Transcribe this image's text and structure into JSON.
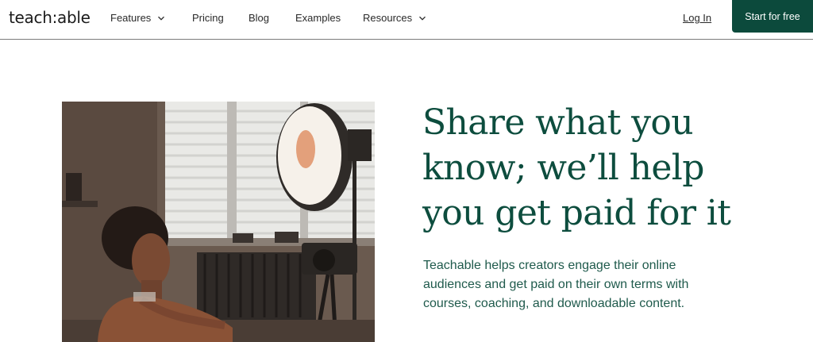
{
  "header": {
    "logo_text": "teach:able",
    "nav": [
      {
        "label": "Features",
        "has_dropdown": true
      },
      {
        "label": "Pricing",
        "has_dropdown": false
      },
      {
        "label": "Blog",
        "has_dropdown": false
      },
      {
        "label": "Examples",
        "has_dropdown": false
      },
      {
        "label": "Resources",
        "has_dropdown": true
      }
    ],
    "login_label": "Log In",
    "cta_label": "Start for free"
  },
  "hero": {
    "headline": "Share what you know; we’ll help you get paid for it",
    "subtext": "Teachable helps creators engage their online audiences and get paid on their own terms with courses, coaching, and downloadable content.",
    "image_icon": "creator-photo"
  },
  "colors": {
    "brand_green": "#0c4a3c",
    "headline_green": "#0d4d3e",
    "divider": "#7a7a7a"
  }
}
